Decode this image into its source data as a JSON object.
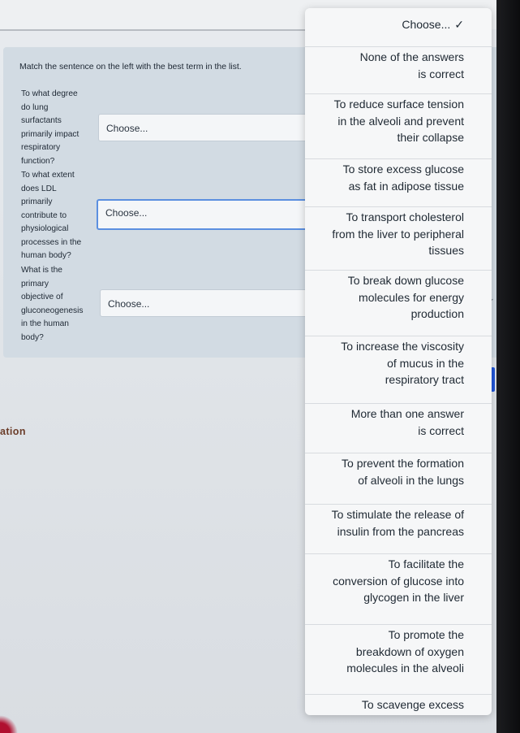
{
  "page": {
    "instructions": "Match the sentence on the left with the best term in the list.",
    "partial_heading": "ation"
  },
  "questions": [
    {
      "text": "To what degree\ndo lung\nsurfactants\nprimarily impact\nrespiratory\nfunction?",
      "selected": "Choose..."
    },
    {
      "text": "To what extent\ndoes LDL\nprimarily\ncontribute to\nphysiological\nprocesses in the\nhuman body?",
      "selected": "Choose..."
    },
    {
      "text": "What is the\nprimary\nobjective of\ngluconeogenesis\nin the human\nbody?",
      "selected": "Choose..."
    }
  ],
  "dropdown": {
    "selected_label": "Choose...",
    "options": [
      "None of the answers\nis correct",
      "To reduce surface tension\nin the alveoli and prevent\ntheir collapse",
      "To store excess glucose\nas fat in adipose tissue",
      "To transport cholesterol\nfrom the liver to peripheral\ntissues",
      "To break down glucose\nmolecules for energy\nproduction",
      "To increase the viscosity\nof mucus in the\nrespiratory tract",
      "More than one answer\nis correct",
      "To prevent the formation\nof alveoli in the lungs",
      "To stimulate the release of\ninsulin from the pancreas",
      "To facilitate the\nconversion of glucose into\nglycogen in the liver",
      "To promote the\nbreakdown of oxygen\nmolecules in the alveoli",
      "To scavenge excess"
    ]
  }
}
